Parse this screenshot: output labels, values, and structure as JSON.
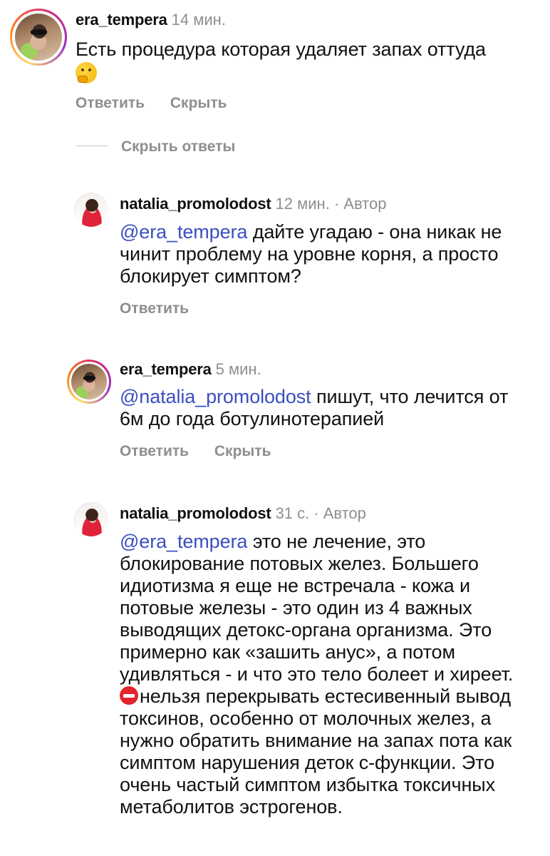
{
  "thread": {
    "hide_replies_label": "Скрыть ответы"
  },
  "comments": [
    {
      "username": "era_tempera",
      "time": "14 мин.",
      "text": "Есть процедура которая удаляет запах оттуда",
      "emoji": "thinking-face",
      "actions": [
        "Ответить",
        "Скрыть"
      ]
    },
    {
      "username": "natalia_promolodost",
      "time": "12 мин.",
      "badge": "· Автор",
      "mention": "@era_tempera",
      "text": " дайте угадаю - она никак не чинит проблему на уровне корня, а просто блокирует симптом?",
      "actions": [
        "Ответить"
      ]
    },
    {
      "username": "era_tempera",
      "time": "5 мин.",
      "mention": "@natalia_promolodost",
      "text": " пишут, что лечится от 6м до года ботулинотерапией",
      "actions": [
        "Ответить",
        "Скрыть"
      ]
    },
    {
      "username": "natalia_promolodost",
      "time": "31 с.",
      "badge": "· Автор",
      "mention": "@era_tempera",
      "text_before_emoji": " это не лечение, это блокирование потовых желез. Большего идиотизма я еще не встречала - кожа и потовые железы - это один из 4 важных выводящих детокс-органа организма. Это примерно как «зашить анус», а потом удивляться - и что это тело болеет и хиреет. ",
      "emoji": "no-entry",
      "text_after_emoji": "нельзя перекрывать естесивенный вывод токсинов, особенно от молочных желез, а нужно обратить внимание на запах пота как симптом нарушения деток с-функции. Это очень частый симптом избытка токсичных метаболитов эстрогенов."
    }
  ]
}
